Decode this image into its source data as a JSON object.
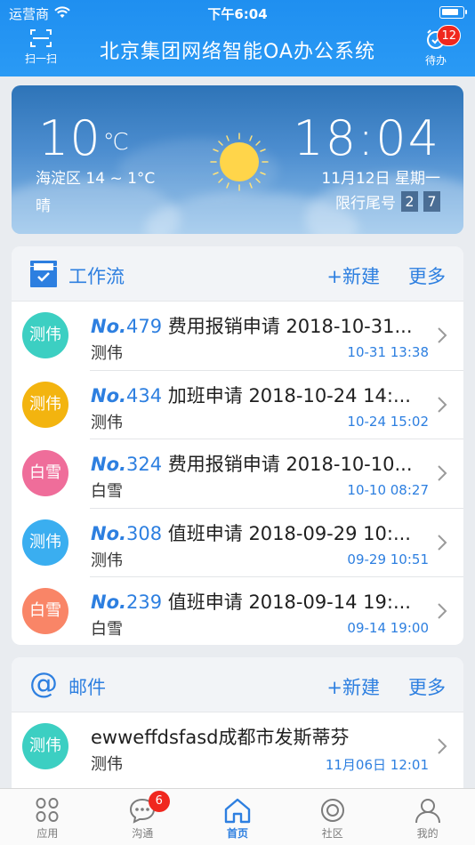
{
  "status_bar": {
    "carrier": "运营商",
    "time": "下午6:04"
  },
  "header": {
    "title": "北京集团网络智能OA办公系统",
    "scan_label": "扫一扫",
    "todo_label": "待办",
    "todo_count": "12"
  },
  "weather": {
    "temperature": "10",
    "temp_unit": "℃",
    "location_range": "海淀区 14 ~ 1°C",
    "condition": "晴",
    "time": "18:04",
    "date": "11月12日 星期一",
    "plate_label": "限行尾号",
    "plate_numbers": [
      "2",
      "7"
    ]
  },
  "workflow": {
    "title": "工作流",
    "new_label": "+新建",
    "more_label": "更多",
    "items": [
      {
        "no_prefix": "No.",
        "number": "479",
        "title": "费用报销申请 2018-10-31...",
        "avatar": "测伟",
        "avatar_color": "#3ccfc2",
        "name": "测伟",
        "time": "10-31 13:38"
      },
      {
        "no_prefix": "No.",
        "number": "434",
        "title": "加班申请 2018-10-24 14:...",
        "avatar": "测伟",
        "avatar_color": "#f3b40f",
        "name": "测伟",
        "time": "10-24 15:02"
      },
      {
        "no_prefix": "No.",
        "number": "324",
        "title": "费用报销申请 2018-10-10...",
        "avatar": "白雪",
        "avatar_color": "#ef6d9a",
        "name": "白雪",
        "time": "10-10 08:27"
      },
      {
        "no_prefix": "No.",
        "number": "308",
        "title": "值班申请 2018-09-29 10:...",
        "avatar": "测伟",
        "avatar_color": "#3aaef0",
        "name": "测伟",
        "time": "09-29 10:51"
      },
      {
        "no_prefix": "No.",
        "number": "239",
        "title": "值班申请 2018-09-14 19:...",
        "avatar": "白雪",
        "avatar_color": "#f98567",
        "name": "白雪",
        "time": "09-14 19:00"
      }
    ]
  },
  "mail": {
    "title": "邮件",
    "new_label": "+新建",
    "more_label": "更多",
    "items": [
      {
        "title": "ewweffdsfasd成都市发斯蒂芬",
        "avatar": "测伟",
        "avatar_color": "#3ccfc2",
        "name": "测伟",
        "time": "11月06日 12:01"
      }
    ]
  },
  "tabbar": {
    "tabs": [
      {
        "label": "应用",
        "icon": "apps-icon"
      },
      {
        "label": "沟通",
        "icon": "chat-icon",
        "badge": "6"
      },
      {
        "label": "首页",
        "icon": "home-icon",
        "active": true
      },
      {
        "label": "社区",
        "icon": "community-icon"
      },
      {
        "label": "我的",
        "icon": "profile-icon"
      }
    ]
  },
  "colors": {
    "accent": "#2d7fe0",
    "header": "#2a9af5",
    "badge": "#f0271e"
  }
}
